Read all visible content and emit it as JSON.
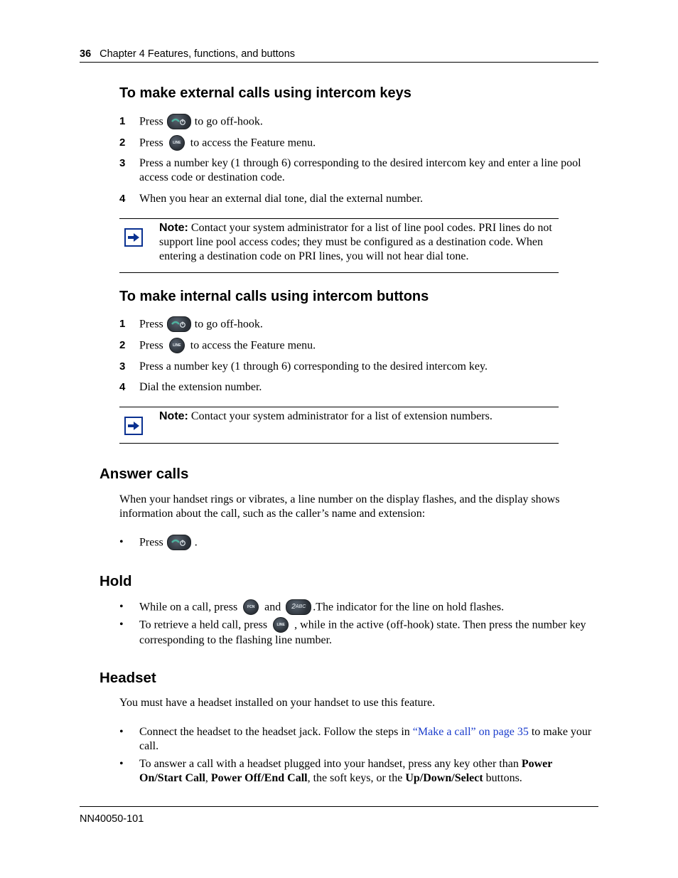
{
  "header": {
    "page_number": "36",
    "chapter": "Chapter 4  Features, functions, and buttons"
  },
  "sections": {
    "external": {
      "title": "To make external calls using intercom keys",
      "steps": [
        {
          "num": "1",
          "pre": "Press",
          "icon": "call-key-icon",
          "post": "to go off-hook."
        },
        {
          "num": "2",
          "pre": "Press",
          "icon": "line-key-icon",
          "post": "to access the Feature menu."
        },
        {
          "num": "3",
          "text": "Press a number key (1 through 6) corresponding to the desired intercom key and enter a line pool access code or destination code."
        },
        {
          "num": "4",
          "text": "When you hear an external dial tone, dial the external number."
        }
      ],
      "note": {
        "label": "Note:",
        "text": "Contact your system administrator for a list of line pool codes. PRI lines do not support line pool access codes; they must be configured as a destination code. When entering a destination code on PRI lines, you will not hear dial tone."
      }
    },
    "internal": {
      "title": "To make internal calls using intercom buttons",
      "steps": [
        {
          "num": "1",
          "pre": "Press",
          "icon": "call-key-icon",
          "post": "to go off-hook."
        },
        {
          "num": "2",
          "pre": "Press",
          "icon": "line-key-icon",
          "post": "to access the Feature menu."
        },
        {
          "num": "3",
          "text": "Press a number key (1 through 6) corresponding to the desired intercom key."
        },
        {
          "num": "4",
          "text": "Dial the extension number."
        }
      ],
      "note": {
        "label": "Note:",
        "text": "Contact your system administrator for a list of extension numbers."
      }
    },
    "answer": {
      "title": "Answer calls",
      "para": "When your handset rings or vibrates, a line number on the display flashes, and the display shows information about the call, such as the caller’s name and extension:",
      "bullet_pre": "Press",
      "bullet_post": "."
    },
    "hold": {
      "title": "Hold",
      "bullet1_pre": "While on a call, press",
      "bullet1_mid": "and",
      "bullet1_post": ".The indicator for the line on hold flashes.",
      "bullet2_pre": "To retrieve a held call, press",
      "bullet2_post": ", while in the active (off-hook) state. Then press the number key corresponding to the flashing line number."
    },
    "headset": {
      "title": "Headset",
      "para": "You must have a headset installed on your handset to use this feature.",
      "bullet1_pre": "Connect the headset to the headset jack. Follow the steps in ",
      "bullet1_link": "“Make a call” on page 35",
      "bullet1_post": " to make your call.",
      "bullet2_a": "To answer a call with a headset plugged into your handset, press any key other than ",
      "bullet2_b": "Power On/Start Call",
      "bullet2_c": ", ",
      "bullet2_d": "Power Off/End Call",
      "bullet2_e": ", the soft keys, or the ",
      "bullet2_f": "Up/Down/Select",
      "bullet2_g": " buttons."
    }
  },
  "keys": {
    "line_label": "LINE",
    "fcn_label": "FCN",
    "two_label": "2",
    "two_letters": "ABC"
  },
  "footer": {
    "doc_number": "NN40050-101"
  },
  "colors": {
    "link": "#1a3ccc",
    "note_icon": "#0a3191"
  }
}
